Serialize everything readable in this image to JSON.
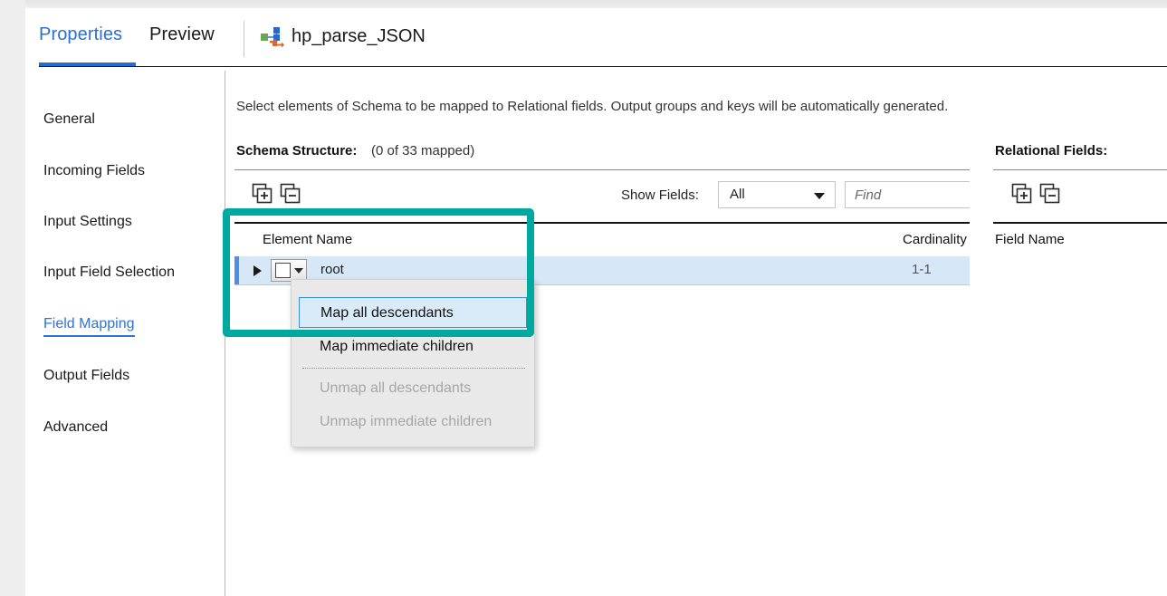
{
  "window": {
    "tabs": [
      {
        "label": "Properties",
        "active": true
      },
      {
        "label": "Preview",
        "active": false
      }
    ],
    "object_icon": "transformation-icon",
    "object_title": "hp_parse_JSON"
  },
  "sidebar": {
    "items": [
      {
        "label": "General",
        "active": false
      },
      {
        "label": "Incoming Fields",
        "active": false
      },
      {
        "label": "Input Settings",
        "active": false
      },
      {
        "label": "Input Field Selection",
        "active": false
      },
      {
        "label": "Field Mapping",
        "active": true
      },
      {
        "label": "Output Fields",
        "active": false
      },
      {
        "label": "Advanced",
        "active": false
      }
    ]
  },
  "main": {
    "instruction": "Select elements of Schema to be mapped to Relational fields. Output groups and keys will be automatically generated.",
    "schema_label": "Schema Structure:",
    "schema_count": "(0 of 33 mapped)",
    "toolbar": {
      "expand_all_icon": "expand-all-icon",
      "collapse_all_icon": "collapse-all-icon",
      "show_fields_label": "Show Fields:",
      "show_fields_value": "All",
      "show_fields_options": [
        "All"
      ],
      "find_value": "",
      "find_placeholder": "Find"
    },
    "grid": {
      "columns": [
        "Element Name",
        "Cardinality"
      ],
      "rows": [
        {
          "name": "root",
          "cardinality": "1-1",
          "selected": true,
          "expanded": false,
          "checked": false
        }
      ]
    }
  },
  "relational": {
    "title": "Relational Fields:",
    "expand_all_icon": "expand-all-icon",
    "collapse_all_icon": "collapse-all-icon",
    "column": "Field Name",
    "rows": []
  },
  "context_menu": {
    "items": [
      {
        "label": "Map all descendants",
        "state": "highlighted"
      },
      {
        "label": "Map immediate children",
        "state": "enabled"
      },
      {
        "label": "Unmap all descendants",
        "state": "disabled"
      },
      {
        "label": "Unmap immediate children",
        "state": "disabled"
      }
    ]
  },
  "annotation": {
    "color": "#00a9a0",
    "shape": "rectangle-highlight"
  },
  "colors": {
    "accent_blue": "#1f6fd0",
    "link_blue": "#2b74dd",
    "row_selected": "#d6e8f8",
    "row_marker": "#4a90e8",
    "annotation_teal": "#00a9a0",
    "menu_bg": "#e9e9e9"
  }
}
